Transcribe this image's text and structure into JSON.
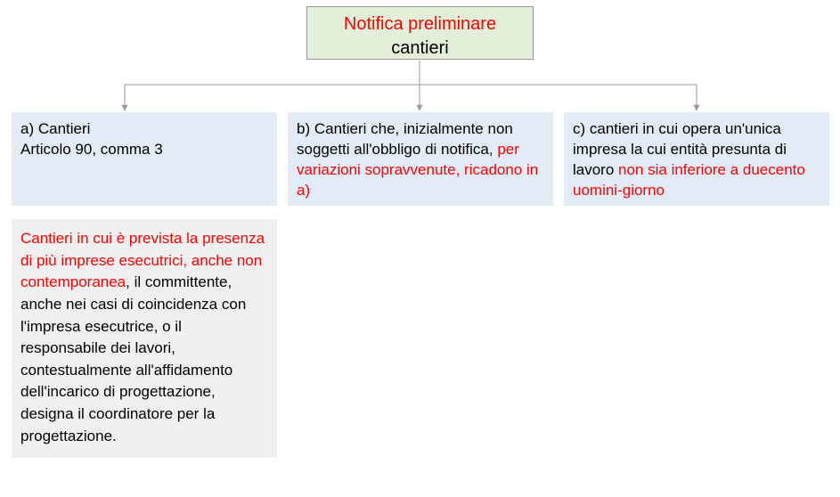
{
  "root": {
    "title": "Notifica preliminare",
    "subtitle": "cantieri"
  },
  "children": {
    "a": {
      "line1": "a) Cantieri",
      "line2": "Articolo 90, comma 3"
    },
    "b": {
      "prefix": "b) Cantieri che, inizialmente non soggetti all'obbligo di notifica, ",
      "red": "per variazioni sopravvenute, ricadono in a)"
    },
    "c": {
      "prefix": "c) cantieri in cui opera un'unica impresa la cui entità presunta di lavoro ",
      "red": "non sia inferiore a duecento uomini-giorno"
    }
  },
  "detail": {
    "red": "Cantieri in cui è prevista la presenza di più imprese esecutrici, anche non contemporanea",
    "rest": ", il committente, anche nei casi di coincidenza con l'impresa esecutrice, o il responsabile dei lavori, contestualmente all'affidamento dell'incarico di progettazione, designa il coordinatore per la progettazione."
  }
}
